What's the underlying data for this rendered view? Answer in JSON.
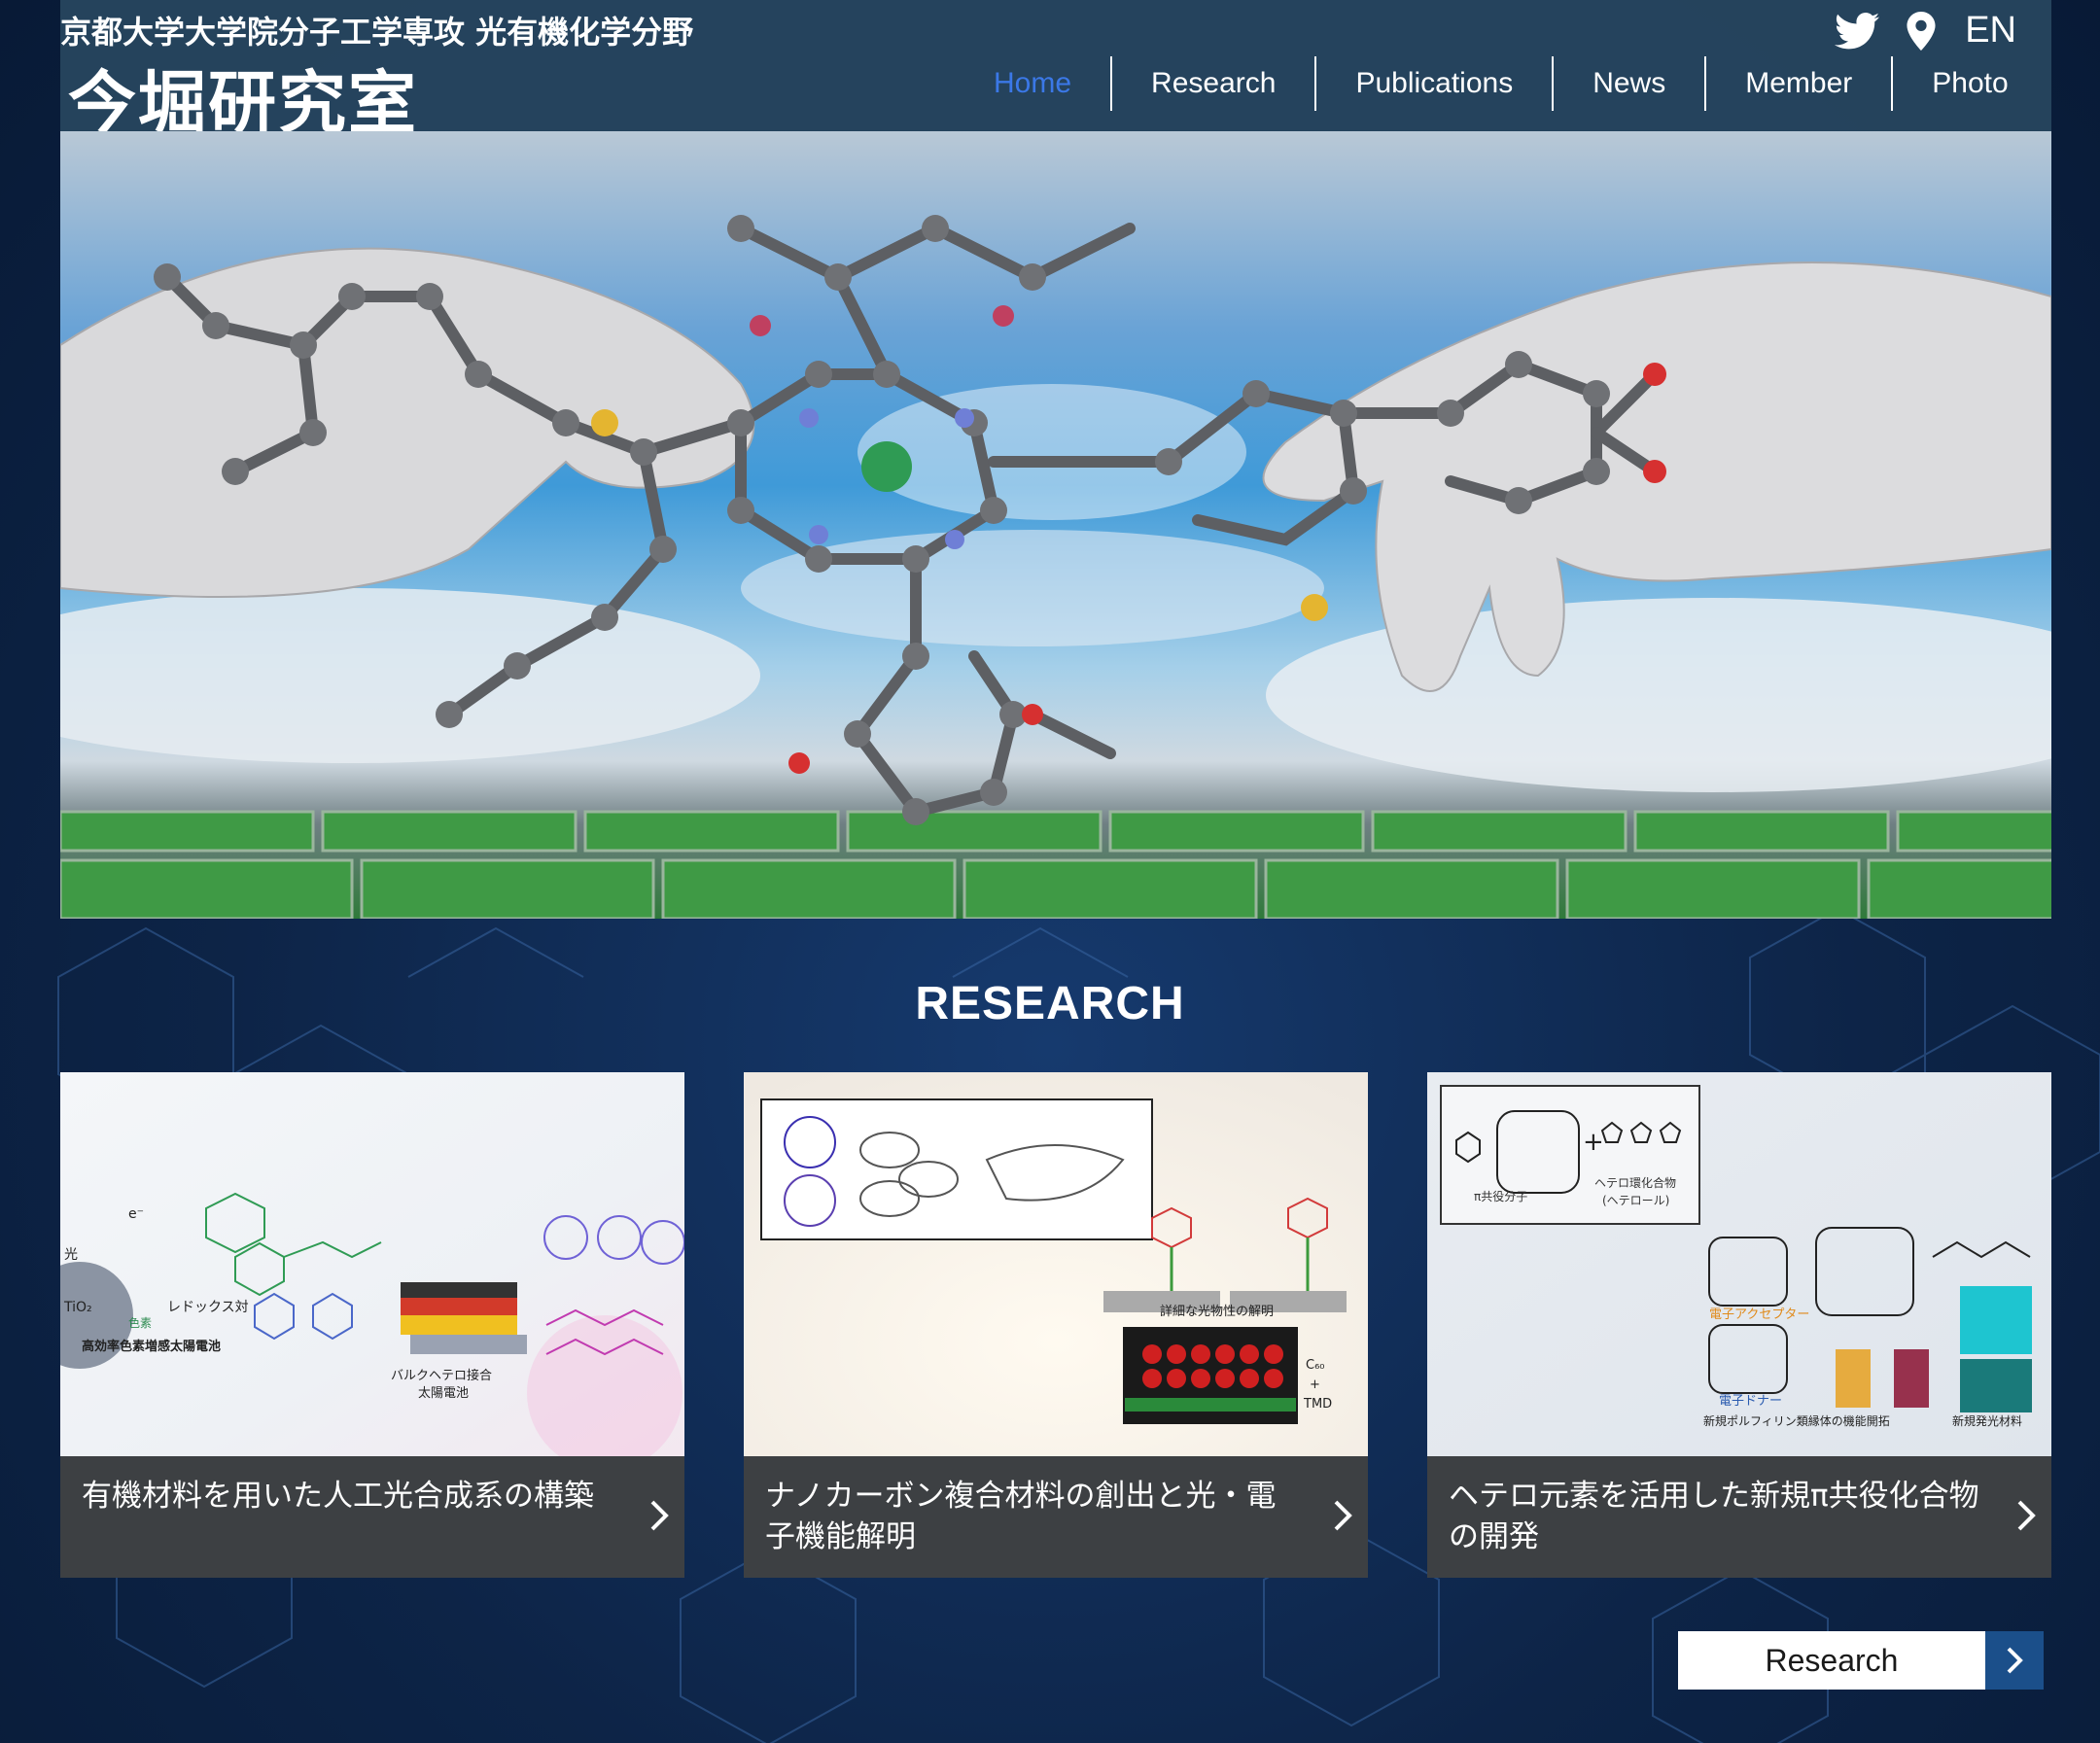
{
  "header": {
    "subtitle": "京都大学大学院分子工学専攻 光有機化学分野",
    "title": "今堀研究室",
    "nav": [
      {
        "label": "Home",
        "active": true
      },
      {
        "label": "Research",
        "active": false
      },
      {
        "label": "Publications",
        "active": false
      },
      {
        "label": "News",
        "active": false
      },
      {
        "label": "Member",
        "active": false
      },
      {
        "label": "Photo",
        "active": false
      }
    ],
    "icons": [
      "twitter-icon",
      "map-pin-icon"
    ],
    "language": "EN"
  },
  "research": {
    "section_title": "RESEARCH",
    "cards": [
      {
        "caption": "有機材料を用いた人工光合成系の構築",
        "image_labels": [
          "光",
          "TiO₂",
          "e⁻",
          "レドックス対",
          "色素",
          "高効率色素増感太陽電池",
          "バルクヘテロ接合",
          "太陽電池"
        ]
      },
      {
        "caption": "ナノカーボン複合材料の創出と光・電子機能解明",
        "image_labels": [
          "詳細な光物性の解明",
          "C₆₀",
          "+",
          "TMD"
        ]
      },
      {
        "caption": "ヘテロ元素を活用した新規π共役化合物の開発",
        "image_labels": [
          "π共役分子",
          "ヘテロ環化合物",
          "(ヘテロール)",
          "電子アクセプター",
          "電子ドナー",
          "新規ポルフィリン類縁体の機能開拓",
          "新規発光材料"
        ]
      }
    ],
    "button_label": "Research"
  },
  "colors": {
    "header_bg": "#28465f",
    "nav_active": "#3b78e7",
    "page_bg": "#0d2447",
    "caption_bg": "#3d4043",
    "button_arrow_bg": "#1b4f8a"
  }
}
